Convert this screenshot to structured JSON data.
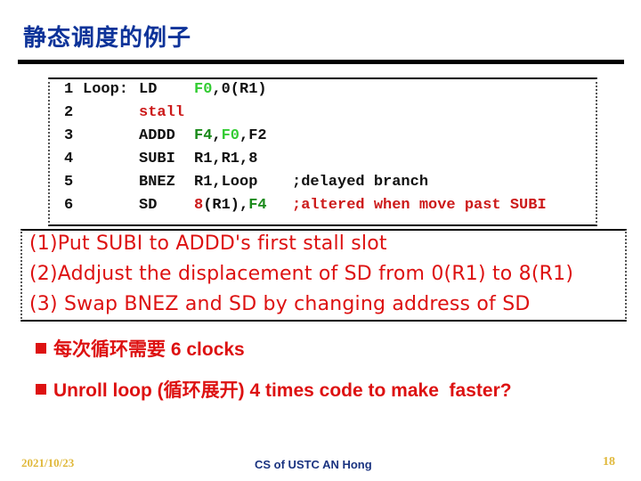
{
  "title": "静态调度的例子",
  "code": {
    "lines": [
      {
        "num": "1",
        "label": "Loop:",
        "op": "LD",
        "args": [
          {
            "text": "F0",
            "color": "lgreen"
          },
          {
            "text": ",0(R1)",
            "color": ""
          }
        ],
        "comment": ""
      },
      {
        "num": "2",
        "label": "",
        "op": "stall",
        "op_color": "red",
        "args": [],
        "comment": ""
      },
      {
        "num": "3",
        "label": "",
        "op": "ADDD",
        "args": [
          {
            "text": "F4",
            "color": "dgreen"
          },
          {
            "text": ",",
            "color": ""
          },
          {
            "text": "F0",
            "color": "lgreen"
          },
          {
            "text": ",F2",
            "color": ""
          }
        ],
        "comment": ""
      },
      {
        "num": "4",
        "label": "",
        "op": "SUBI",
        "args": [
          {
            "text": "R1,R1,8",
            "color": ""
          }
        ],
        "comment": ""
      },
      {
        "num": "5",
        "label": "",
        "op": "BNEZ",
        "args": [
          {
            "text": "R1,Loop",
            "color": ""
          }
        ],
        "comment": ";delayed branch"
      },
      {
        "num": "6",
        "label": "",
        "op": "SD",
        "args": [
          {
            "text": "8",
            "color": "red"
          },
          {
            "text": "(R1),",
            "color": ""
          },
          {
            "text": "F4",
            "color": "dgreen"
          }
        ],
        "comment": ";altered when move past SUBI",
        "comment_color": "red"
      }
    ]
  },
  "notes": [
    "(1)Put SUBI to ADDD's first stall slot",
    "(2)Addjust the displacement of SD from 0(R1) to 8(R1)",
    "(3) Swap BNEZ and SD by changing address of SD"
  ],
  "bullets": [
    "每次循环需要 6 clocks",
    "Unroll loop (循环展开) 4 times code to make  faster?"
  ],
  "footer": {
    "date": "2021/10/23",
    "center": "CS of USTC AN Hong",
    "page": "18"
  },
  "colors": {
    "title": "#0d3399",
    "accent_red": "#dd1111",
    "light_green": "#33cc33",
    "dark_green": "#1a8a1a",
    "footer_gold": "#e0b83a",
    "footer_blue": "#1a3380"
  }
}
